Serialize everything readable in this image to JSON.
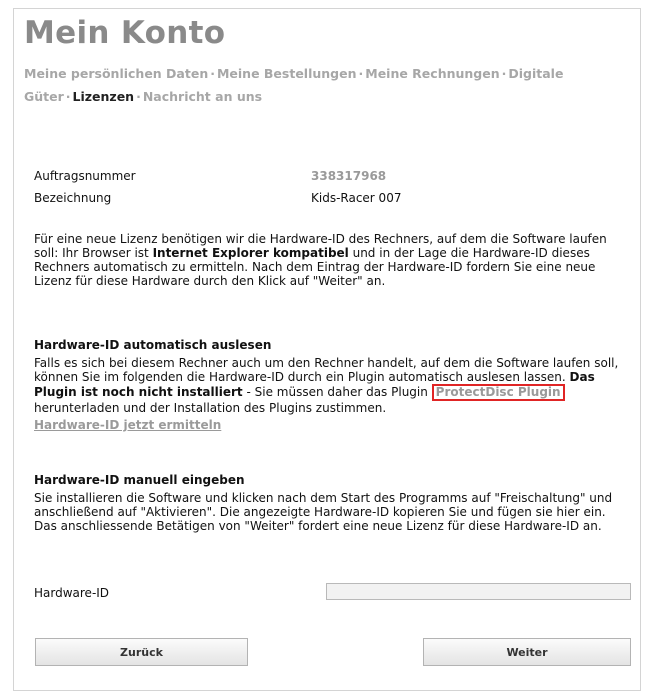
{
  "page": {
    "title": "Mein Konto"
  },
  "nav": {
    "items": [
      {
        "label": "Meine persönlichen Daten",
        "active": false
      },
      {
        "label": "Meine Bestellungen",
        "active": false
      },
      {
        "label": "Meine Rechnungen",
        "active": false
      },
      {
        "label": "Digitale Güter",
        "active": false
      },
      {
        "label": "Lizenzen",
        "active": true
      },
      {
        "label": "Nachricht an uns",
        "active": false
      }
    ],
    "separator": "·"
  },
  "order": {
    "number_label": "Auftragsnummer",
    "number_value": "338317968",
    "name_label": "Bezeichnung",
    "name_value": "Kids-Racer 007"
  },
  "intro": {
    "text_1": "Für eine neue Lizenz benötigen wir die Hardware-ID des Rechners, auf dem die Software laufen soll: Ihr Browser ist ",
    "bold_1": "Internet Explorer kompatibel",
    "text_2": " und in der Lage die Hardware-ID dieses Rechners automatisch zu ermitteln. Nach dem Eintrag der Hardware-ID fordern Sie eine neue Lizenz für diese Hardware durch den Klick auf \"Weiter\" an."
  },
  "auto": {
    "heading": "Hardware-ID automatisch auslesen",
    "text_1": "Falls es sich bei diesem Rechner auch um den Rechner handelt, auf dem die Software laufen soll, können Sie im folgenden die Hardware-ID durch ein Plugin automatisch auslesen lassen. ",
    "bold_1": "Das Plugin ist noch nicht installiert",
    "text_2": " - Sie müssen daher das Plugin ",
    "plugin_link": "ProtectDisc Plugin",
    "text_3": " herunterladen und der Installation des Plugins zustimmen.",
    "determine_link": "Hardware-ID jetzt ermitteln"
  },
  "manual": {
    "heading": "Hardware-ID manuell eingeben",
    "text": "Sie installieren die Software und klicken nach dem Start des Programms auf \"Freischaltung\" und anschließend auf \"Aktivieren\". Die angezeigte Hardware-ID kopieren Sie und fügen sie hier ein. Das anschliessende Betätigen von \"Weiter\" fordert eine neue Lizenz für diese Hardware-ID an."
  },
  "form": {
    "hardware_id_label": "Hardware-ID",
    "hardware_id_value": ""
  },
  "buttons": {
    "back": "Zurück",
    "next": "Weiter"
  }
}
